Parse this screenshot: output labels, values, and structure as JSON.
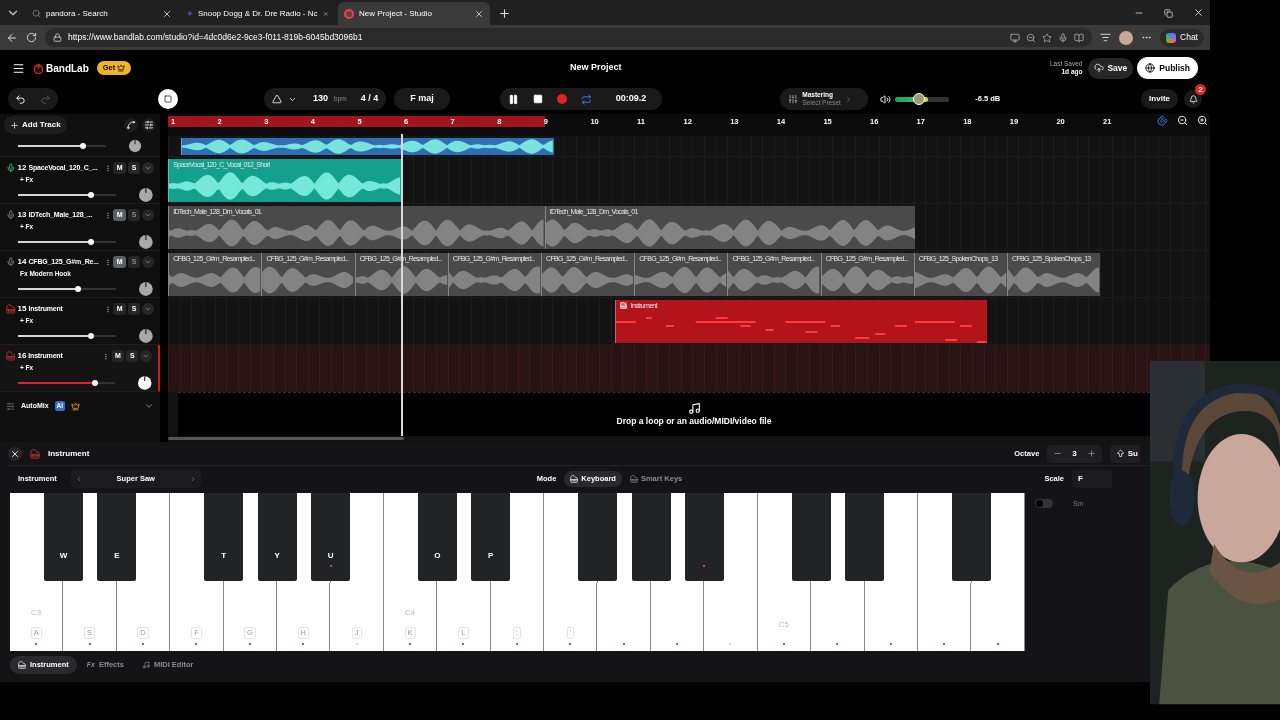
{
  "browser": {
    "tabs": [
      {
        "title": "pandora - Search",
        "kind": "search",
        "selected": false
      },
      {
        "title": "Snoop Dogg & Dr. Dre Radio - Nc",
        "kind": "radio",
        "selected": false
      },
      {
        "title": "New Project - Studio",
        "kind": "studio",
        "selected": true
      }
    ],
    "url": "https://www.bandlab.com/studio?id=4dc0d6e2-9ce3-f011-819b-6045bd3096b1",
    "chat": "Chat"
  },
  "header": {
    "brand": "BandLab",
    "get": "Get",
    "title": "New Project",
    "last_saved_label": "Last Saved",
    "last_saved_value": "1d ago",
    "save": "Save",
    "publish": "Publish"
  },
  "transport": {
    "tempo": "130",
    "tempo_unit": "bpm",
    "time_signature": "4 / 4",
    "key": "F maj",
    "playing": true,
    "loop": true,
    "time": "00:09.2",
    "mastering": "Mastering",
    "preset": "Select Preset",
    "db": "-6.5 dB",
    "invite": "Invite",
    "notifications": "2"
  },
  "tracks_panel": {
    "add_track": "Add Track",
    "automix": "AutoMix",
    "ai": "AI"
  },
  "ruler": {
    "bars": [
      "1",
      "2",
      "3",
      "4",
      "5",
      "6",
      "7",
      "8",
      "9",
      "10",
      "11",
      "12",
      "13",
      "14",
      "15",
      "16",
      "17",
      "18",
      "19",
      "20",
      "21"
    ]
  },
  "tracks": [
    {
      "kind": "partial",
      "level": 0.74,
      "clips": [
        {
          "color": "#2f6db5"
        }
      ]
    },
    {
      "kind": "audio",
      "number": "12",
      "name": "SpaceVocal_120_C_...",
      "fx": "+ Fx",
      "mute": "M",
      "solo": "S",
      "armed": true,
      "muted": false,
      "selected": false,
      "level": 0.74,
      "clips": [
        {
          "name": "SpaceVocal_120_C_Vocal_012_Short",
          "color": "#14a08f"
        }
      ]
    },
    {
      "kind": "audio",
      "number": "13",
      "name": "IDTech_Male_128_...",
      "fx": "+ Fx",
      "mute": "M",
      "solo": "S",
      "armed": false,
      "muted": true,
      "selected": false,
      "level": 0.74,
      "clips": [
        {
          "name": "IDTech_Male_128_Dm_Vocals_01",
          "color": "#4a4a4a"
        },
        {
          "name": "IDTech_Male_128_Dm_Vocals_01",
          "color": "#4a4a4a"
        }
      ]
    },
    {
      "kind": "audio",
      "number": "14",
      "name": "CFBG_125_G#m_Re...",
      "fx": "Fx Modern Hook",
      "mute": "M",
      "solo": "S",
      "armed": false,
      "muted": true,
      "selected": false,
      "level": 0.61,
      "clips": [
        {
          "name": "CFBG_125_G#m_Resampled...",
          "color": "#4a4a4a"
        },
        {
          "name": "CFBG_125_G#m_Resampled...",
          "color": "#4a4a4a"
        },
        {
          "name": "CFBG_125_G#m_Resampled...",
          "color": "#4a4a4a"
        },
        {
          "name": "CFBG_125_G#m_Resampled...",
          "color": "#4a4a4a"
        },
        {
          "name": "CFBG_125_G#m_Resampled...",
          "color": "#4a4a4a"
        },
        {
          "name": "CFBG_125_G#m_Resampled...",
          "color": "#4a4a4a"
        },
        {
          "name": "CFBG_125_G#m_Resampled...",
          "color": "#4a4a4a"
        },
        {
          "name": "CFBG_125_G#m_Resampled...",
          "color": "#4a4a4a"
        },
        {
          "name": "CFBG_125_SpokenChops_13",
          "color": "#4a4a4a"
        },
        {
          "name": "CFBG_125_SpokenChops_13",
          "color": "#4a4a4a"
        }
      ]
    },
    {
      "kind": "instrument",
      "number": "15",
      "name": "Instrument",
      "fx": "+ Fx",
      "mute": "M",
      "solo": "S",
      "muted": false,
      "selected": false,
      "level": 0.74,
      "clips": [
        {
          "name": "Instrument",
          "color": "#b3141b",
          "kind": "midi"
        }
      ]
    },
    {
      "kind": "instrument",
      "number": "16",
      "name": "Instrument",
      "fx": "+ Fx",
      "mute": "M",
      "solo": "S",
      "muted": false,
      "selected": true,
      "level": 0.8
    }
  ],
  "drop_zone": "Drop a loop or an audio/MIDI/video file",
  "instrument_panel": {
    "title": "Instrument",
    "octave_label": "Octave",
    "octave": "3",
    "sustain": "Su",
    "instrument_label": "Instrument",
    "instrument": "Super Saw",
    "mode_label": "Mode",
    "modes": [
      {
        "label": "Keyboard",
        "selected": true
      },
      {
        "label": "Smart Keys",
        "selected": false
      }
    ],
    "scale_label": "Scale",
    "scale": "F",
    "smart_label": "Sm",
    "smart_on": false,
    "white_keys": [
      {
        "key": "A",
        "note": "C3",
        "in_scale": true
      },
      {
        "key": "S",
        "in_scale": true
      },
      {
        "key": "D",
        "in_scale": true
      },
      {
        "key": "F",
        "in_scale": true
      },
      {
        "key": "G",
        "in_scale": true
      },
      {
        "key": "H",
        "in_scale": true
      },
      {
        "key": "J",
        "in_scale": false
      },
      {
        "key": "K",
        "note": "C4",
        "in_scale": true
      },
      {
        "key": "L",
        "in_scale": true
      },
      {
        "key": ";",
        "in_scale": true
      },
      {
        "key": "'",
        "in_scale": true
      },
      {
        "in_scale": true
      },
      {
        "in_scale": true
      },
      {
        "in_scale": false
      },
      {
        "note": "C5",
        "in_scale": true
      },
      {
        "in_scale": true
      },
      {
        "in_scale": true
      },
      {
        "in_scale": true
      },
      {
        "in_scale": true
      }
    ],
    "black_keys": [
      {
        "key": "W",
        "in_scale": false
      },
      {
        "key": "E",
        "in_scale": false
      },
      {
        "key": "T",
        "in_scale": false
      },
      {
        "key": "Y",
        "in_scale": false
      },
      {
        "key": "U",
        "in_scale": true
      },
      {
        "key": "O",
        "in_scale": false
      },
      {
        "key": "P",
        "in_scale": false
      },
      {
        "in_scale": false
      },
      {
        "in_scale": false
      },
      {
        "in_scale": true
      },
      {
        "in_scale": false
      },
      {
        "in_scale": false
      },
      {
        "in_scale": false
      }
    ],
    "tabs": [
      {
        "label": "Instrument",
        "kind": "piano",
        "selected": true
      },
      {
        "label": "Effects",
        "kind": "fx",
        "icon_text": "Fx",
        "selected": false
      },
      {
        "label": "MIDI Editor",
        "kind": "midi",
        "selected": false
      }
    ]
  }
}
